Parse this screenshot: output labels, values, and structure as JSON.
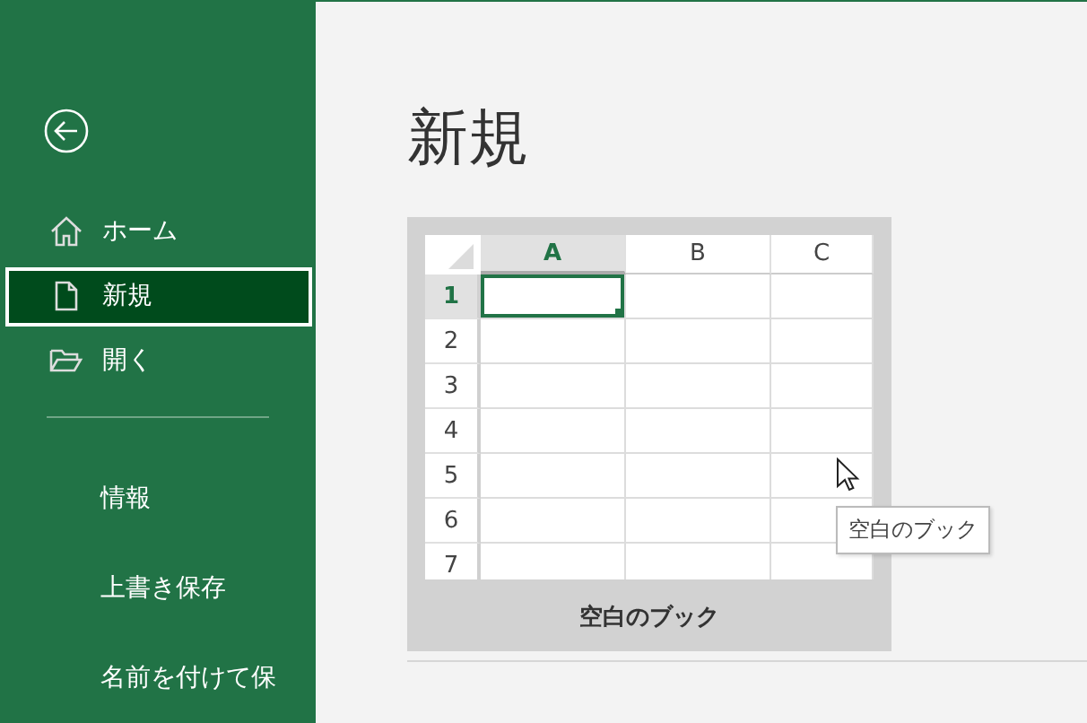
{
  "sidebar": {
    "primary": [
      {
        "label": "ホーム",
        "selected": false
      },
      {
        "label": "新規",
        "selected": true
      },
      {
        "label": "開く",
        "selected": false
      }
    ],
    "secondary": [
      {
        "label": "情報"
      },
      {
        "label": "上書き保存"
      },
      {
        "label": "名前を付けて保"
      }
    ]
  },
  "main": {
    "title": "新規",
    "templates": [
      {
        "label": "空白のブック",
        "tooltip": "空白のブック",
        "sheet": {
          "columns": [
            {
              "label": "A",
              "selected": true
            },
            {
              "label": "B",
              "selected": false
            },
            {
              "label": "C",
              "selected": false
            }
          ],
          "rows": [
            {
              "label": "1",
              "selected": true
            },
            {
              "label": "2",
              "selected": false
            },
            {
              "label": "3",
              "selected": false
            },
            {
              "label": "4",
              "selected": false
            },
            {
              "label": "5",
              "selected": false
            },
            {
              "label": "6",
              "selected": false
            },
            {
              "label": "7",
              "selected": false
            }
          ]
        }
      }
    ]
  }
}
